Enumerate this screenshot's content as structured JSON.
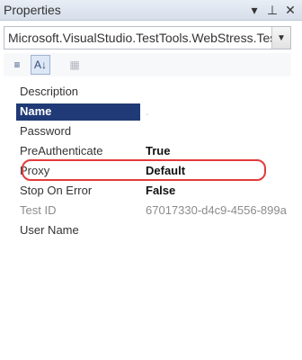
{
  "window": {
    "title": "Properties",
    "controls": [
      "pin-icon",
      "dock-icon",
      "close-icon"
    ]
  },
  "object_selector": {
    "value": "Microsoft.VisualStudio.TestTools.WebStress.Tes"
  },
  "toolbar": {
    "buttons": [
      {
        "name": "categorized-icon",
        "glyph": "≡"
      },
      {
        "name": "alphabetical-icon",
        "glyph": "A↓"
      },
      {
        "name": "property-pages-icon",
        "glyph": "▦"
      }
    ]
  },
  "properties": [
    {
      "label": "Description",
      "value": ""
    },
    {
      "label": "Name",
      "value": "."
    },
    {
      "label": "Password",
      "value": ""
    },
    {
      "label": "PreAuthenticate",
      "value": "True"
    },
    {
      "label": "Proxy",
      "value": "Default"
    },
    {
      "label": "Stop On Error",
      "value": "False"
    },
    {
      "label": "Test ID",
      "value": "67017330-d4c9-4556-899a"
    },
    {
      "label": "User Name",
      "value": ""
    }
  ],
  "colors": {
    "selection": "#1f3a76",
    "highlight_ring": "#e23b3b"
  }
}
